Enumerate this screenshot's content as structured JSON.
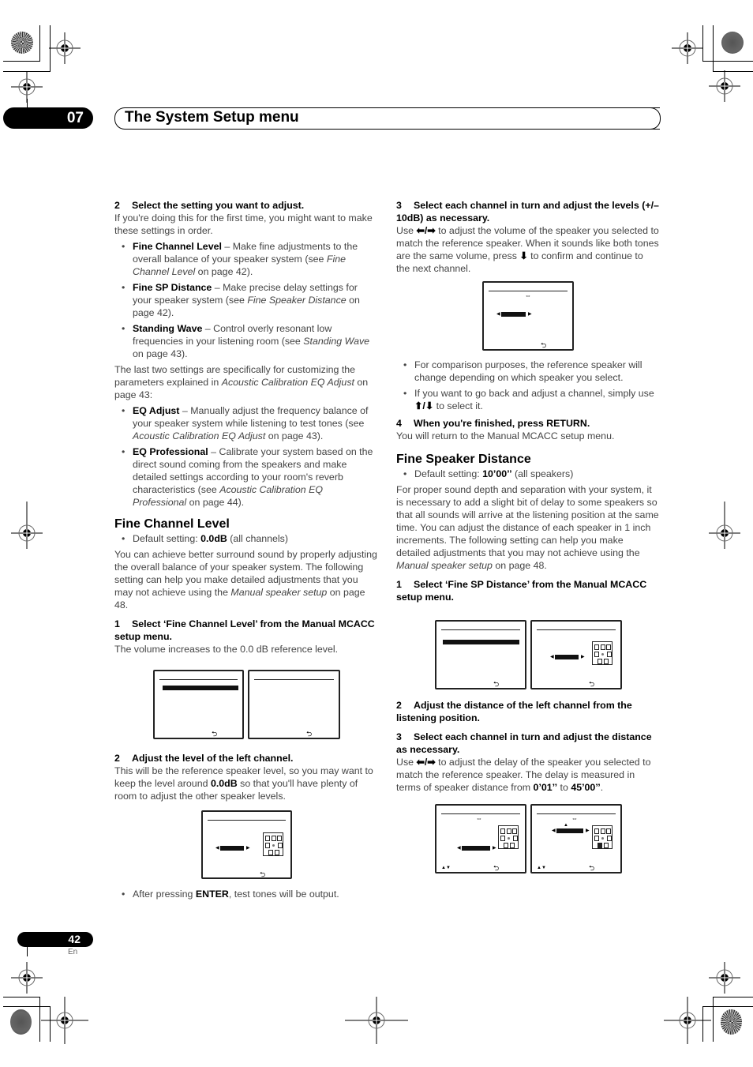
{
  "header": {
    "chapter_number": "07",
    "chapter_title": "The System Setup menu"
  },
  "left_column": {
    "step2": {
      "number": "2",
      "heading": "Select the setting you want to adjust.",
      "intro": "If you're doing this for the first time, you might want to make these settings in order.",
      "items": [
        {
          "term": "Fine Channel Level",
          "text_pre": " – Make fine adjustments to the overall balance of your speaker system (see ",
          "ref": "Fine Channel Level",
          "text_post": " on page 42)."
        },
        {
          "term": "Fine SP Distance",
          "text_pre": " – Make precise delay settings for your speaker system (see ",
          "ref": "Fine Speaker Distance",
          "text_post": " on page 42)."
        },
        {
          "term": "Standing Wave",
          "text_pre": " – Control overly resonant low frequencies in your listening room (see ",
          "ref": "Standing Wave",
          "text_post": " on page 43)."
        }
      ],
      "note_pre": "The last two settings are specifically for customizing the parameters explained in ",
      "note_ref": "Acoustic Calibration EQ Adjust",
      "note_post": " on page 43:",
      "items2": [
        {
          "term": "EQ Adjust",
          "text_pre": " – Manually adjust the frequency balance of your speaker system while listening to test tones (see ",
          "ref": "Acoustic Calibration EQ Adjust",
          "text_post": " on page 43)."
        },
        {
          "term": "EQ Professional",
          "text_pre": " – Calibrate your system based on the direct sound coming from the speakers and make detailed settings according to your room's reverb characteristics (see ",
          "ref": "Acoustic Calibration EQ Professional",
          "text_post": " on page 44)."
        }
      ]
    },
    "fine_channel_level": {
      "heading": "Fine Channel Level",
      "default_label": "Default setting: ",
      "default_value": "0.0dB",
      "default_note": " (all channels)",
      "body_pre": "You can achieve better surround sound by properly adjusting the overall balance of your speaker system. The following setting can help you make detailed adjustments that you may not achieve using the ",
      "body_ref": "Manual speaker setup",
      "body_post": " on page 48.",
      "step1_number": "1",
      "step1_heading": "Select ‘Fine Channel Level’ from the Manual MCACC setup menu.",
      "step1_text": "The volume increases to the 0.0 dB reference level.",
      "step2_number": "2",
      "step2_heading": "Adjust the level of the left channel.",
      "step2_text_pre": "This will be the reference speaker level, so you may want to keep the level around ",
      "step2_value": "0.0dB",
      "step2_text_post": " so that you'll have plenty of room to adjust the other speaker levels.",
      "after_pre": "After pressing ",
      "after_key": "ENTER",
      "after_post": ", test tones will be output."
    }
  },
  "right_column": {
    "step3": {
      "number": "3",
      "heading": "Select each channel in turn and adjust the levels (+/–10dB) as necessary.",
      "text_pre": "Use ",
      "keys_lr": "⬅/➡",
      "text_mid": " to adjust the volume of the speaker you selected to match the reference speaker. When it sounds like both tones are the same volume, press ",
      "key_down": "⬇",
      "text_post": " to confirm and continue to the next channel.",
      "bullets": [
        {
          "text": "For comparison purposes, the reference speaker will change depending on which speaker you select."
        },
        {
          "text_pre": "If you want to go back and adjust a channel, simply use ",
          "keys": "⬆/⬇",
          "text_post": " to select it."
        }
      ]
    },
    "step4": {
      "number": "4",
      "heading": "When you're finished, press RETURN.",
      "text": "You will return to the Manual MCACC setup menu."
    },
    "fine_speaker_distance": {
      "heading": "Fine Speaker Distance",
      "default_label": "Default setting: ",
      "default_value": "10’00’’",
      "default_note": " (all speakers)",
      "body_pre": "For proper sound depth and separation with your system, it is necessary to add a slight bit of delay to some speakers so that all sounds will arrive at the listening position at the same time. You can adjust the distance of each speaker in 1 inch increments. The following setting can help you make detailed adjustments that you may not achieve using the ",
      "body_ref": "Manual speaker setup",
      "body_post": " on page 48.",
      "step1_number": "1",
      "step1_heading": "Select ‘Fine SP Distance’ from the Manual MCACC setup menu.",
      "step2_number": "2",
      "step2_heading": "Adjust the distance of the left channel from the listening position.",
      "step3_number": "3",
      "step3_heading": "Select each channel in turn and adjust the distance as necessary.",
      "step3_pre": "Use ",
      "step3_keys": "⬅/➡",
      "step3_mid": " to adjust the delay of the speaker you selected to match the reference speaker. The delay is measured in terms of speaker distance from ",
      "range_min": "0’01’’",
      "range_sep": " to ",
      "range_max": "45’00’’",
      "step3_post": "."
    }
  },
  "osd_icons": {
    "return": "⮌",
    "left_right": "⇔",
    "up_down": "▲▼",
    "arrow_left": "◀",
    "arrow_right": "▶",
    "arrow_up": "▲"
  },
  "footer": {
    "page_number": "42",
    "language": "En"
  }
}
